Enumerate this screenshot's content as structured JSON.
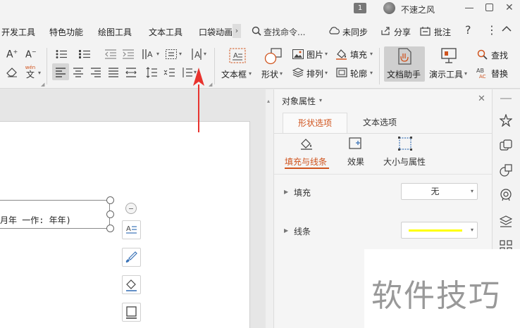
{
  "titlebar": {
    "badge": "1",
    "username": "不速之风"
  },
  "tabs": [
    {
      "label": "开发工具"
    },
    {
      "label": "特色功能"
    },
    {
      "label": "绘图工具"
    },
    {
      "label": "文本工具"
    },
    {
      "label": "口袋动画"
    }
  ],
  "toolbar_right": {
    "search_placeholder": "查找命令...",
    "sync": "未同步",
    "share": "分享",
    "annotate": "批注"
  },
  "ribbon": {
    "textbox": "文本框",
    "shape": "形状",
    "picture": "图片",
    "fill": "填充",
    "arrange": "排列",
    "outline": "轮廓",
    "doc_assistant": "文档助手",
    "demo_tools": "演示工具",
    "find": "查找",
    "replace": "替换",
    "phonetic": "wén"
  },
  "document": {
    "textbox_text": "月年 一作: 年年)"
  },
  "panel": {
    "title": "对象属性",
    "tabs": [
      {
        "label": "形状选项"
      },
      {
        "label": "文本选项"
      }
    ],
    "subtabs": [
      {
        "label": "填充与线条"
      },
      {
        "label": "效果"
      },
      {
        "label": "大小与属性"
      }
    ],
    "fill_label": "填充",
    "fill_value": "无",
    "line_label": "线条",
    "line_color": "#ffff00"
  },
  "watermark": "软件技巧",
  "colors": {
    "accent": "#d0541e",
    "arrow": "#e8332e",
    "line_yellow": "#ffff00"
  }
}
